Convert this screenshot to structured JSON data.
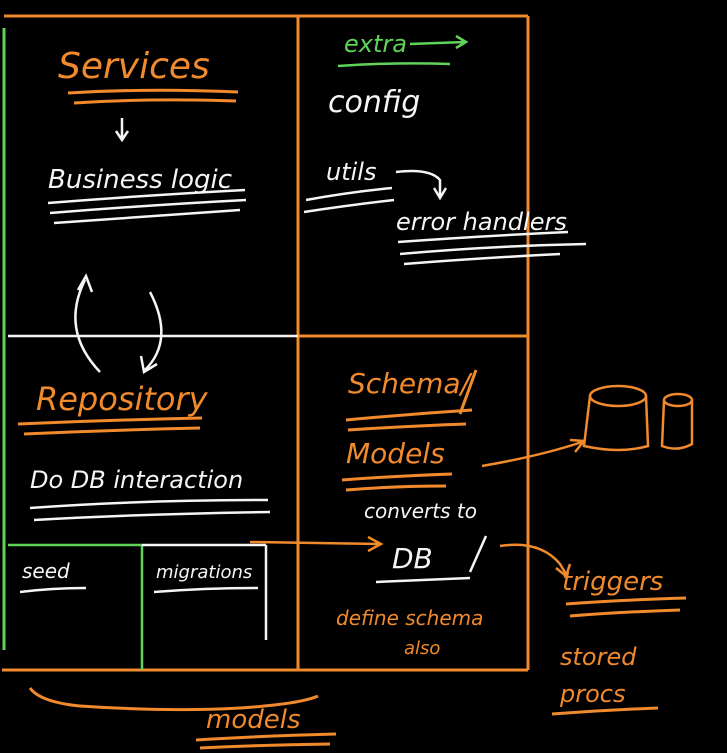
{
  "colors": {
    "orange": "#f08a2c",
    "white": "#f5f5f5",
    "green": "#5fd35a",
    "background": "#000000"
  },
  "labels": {
    "services": "Services",
    "business_logic": "Business logic",
    "extra": "extra",
    "config": "config",
    "utils": "utils",
    "error_handlers": "error handlers",
    "repository": "Repository",
    "do_db": "Do DB interaction",
    "schema": "Schema/",
    "models": "Models",
    "converts_to": "converts to",
    "db": "DB",
    "define_schema": "define schema",
    "also": "also",
    "seed": "seed",
    "migrations": "migrations",
    "triggers": "triggers",
    "stored": "stored",
    "procs": "procs",
    "models_bottom": "models"
  },
  "icons": [
    "database-cylinder-icon",
    "database-small-cylinder-icon"
  ]
}
